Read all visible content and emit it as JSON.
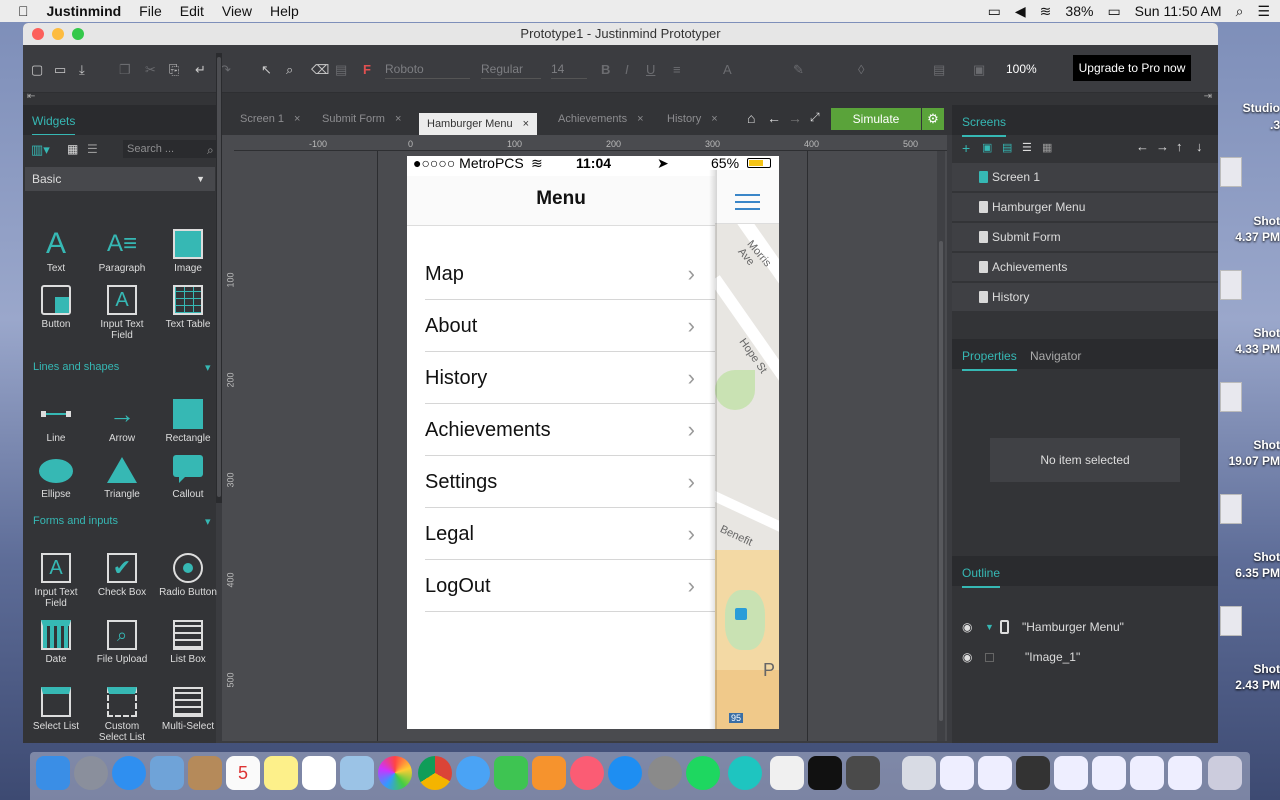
{
  "menubar": {
    "app_name": "Justinmind",
    "items": [
      "File",
      "Edit",
      "View",
      "Help"
    ],
    "battery": "38%",
    "clock": "Sun 11:50 AM"
  },
  "desktop": {
    "labels": [
      "Studio",
      ".3",
      "Shot",
      "4.37 PM",
      "Shot",
      "4.33 PM",
      "Shot",
      "19.07 PM",
      "Shot",
      "6.35 PM",
      "Shot",
      "2.43 PM"
    ]
  },
  "window": {
    "title": "Prototype1 - Justinmind Prototyper",
    "toolbar": {
      "font_name": "Roboto",
      "font_style": "Regular",
      "font_size": "14",
      "zoom": "100%",
      "upgrade_label": "Upgrade to Pro now"
    },
    "widgets_panel": {
      "tab_label": "Widgets",
      "search_placeholder": "Search ...",
      "category": "Basic",
      "basic": [
        "Text",
        "Paragraph",
        "Image",
        "Button",
        "Input Text Field",
        "Text Table"
      ],
      "lines_section": "Lines and shapes",
      "lines": [
        "Line",
        "Arrow",
        "Rectangle",
        "Ellipse",
        "Triangle",
        "Callout"
      ],
      "forms_section": "Forms and inputs",
      "forms": [
        "Input Text Field",
        "Check Box",
        "Radio Button",
        "Date",
        "File Upload",
        "List Box",
        "Select List",
        "Custom Select List",
        "Multi-Select"
      ]
    },
    "tabs": [
      "Screen 1",
      "Submit Form",
      "Hamburger Menu",
      "Achievements",
      "History"
    ],
    "active_tab": "Hamburger Menu",
    "simulate_label": "Simulate",
    "ruler_top": [
      "-100",
      "0",
      "100",
      "200",
      "300",
      "400",
      "500"
    ],
    "ruler_left": [
      "100",
      "200",
      "300",
      "400",
      "500"
    ],
    "phone": {
      "carrier": "●○○○○ MetroPCS",
      "time": "11:04",
      "battery": "65%",
      "title": "Menu",
      "items": [
        "Map",
        "About",
        "History",
        "Achievements",
        "Settings",
        "Legal",
        "LogOut"
      ],
      "map_labels": [
        "Morris Ave",
        "Hope St",
        "Benefit",
        "95",
        "P"
      ]
    },
    "screens_panel": {
      "tab_label": "Screens",
      "screens": [
        "Screen 1",
        "Hamburger Menu",
        "Submit Form",
        "Achievements",
        "History"
      ]
    },
    "properties_panel": {
      "tabs": [
        "Properties",
        "Navigator"
      ],
      "empty": "No item selected"
    },
    "outline_panel": {
      "tab_label": "Outline",
      "items": [
        "\"Hamburger Menu\"",
        "\"Image_1\""
      ]
    }
  },
  "colors": {
    "accent": "#36b8b4",
    "simulate": "#5aa33a",
    "panel": "#333437"
  }
}
